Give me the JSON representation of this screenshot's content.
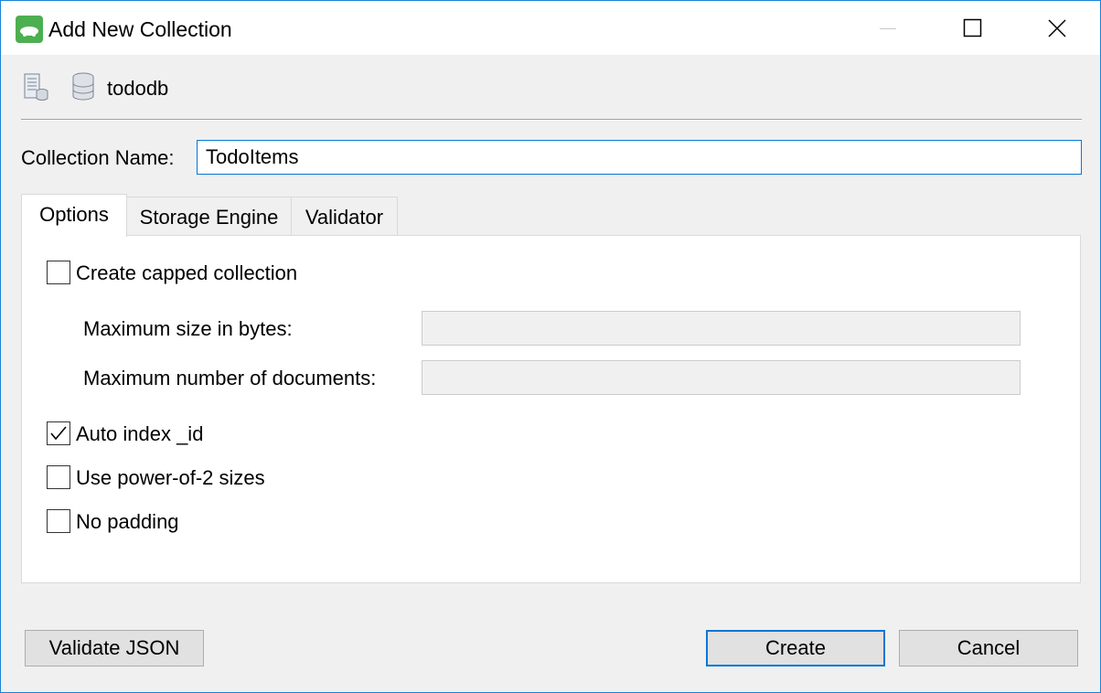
{
  "window": {
    "title": "Add New Collection",
    "app_icon": "mongo-leaf-icon"
  },
  "header": {
    "database_name": "tododb"
  },
  "form": {
    "collection_name_label": "Collection Name:",
    "collection_name_value": "TodoItems"
  },
  "tabs": [
    {
      "label": "Options",
      "selected": true
    },
    {
      "label": "Storage Engine",
      "selected": false
    },
    {
      "label": "Validator",
      "selected": false
    }
  ],
  "options": {
    "capped": {
      "label": "Create capped collection",
      "checked": false
    },
    "max_size_label": "Maximum size in bytes:",
    "max_size_value": "",
    "max_docs_label": "Maximum number of documents:",
    "max_docs_value": "",
    "auto_index": {
      "label": "Auto index _id",
      "checked": true
    },
    "power_of_2": {
      "label": "Use power-of-2 sizes",
      "checked": false
    },
    "no_padding": {
      "label": "No padding",
      "checked": false
    }
  },
  "buttons": {
    "validate": "Validate JSON",
    "create": "Create",
    "cancel": "Cancel"
  },
  "colors": {
    "accent": "#0078d7",
    "window_border": "#1883d7"
  }
}
